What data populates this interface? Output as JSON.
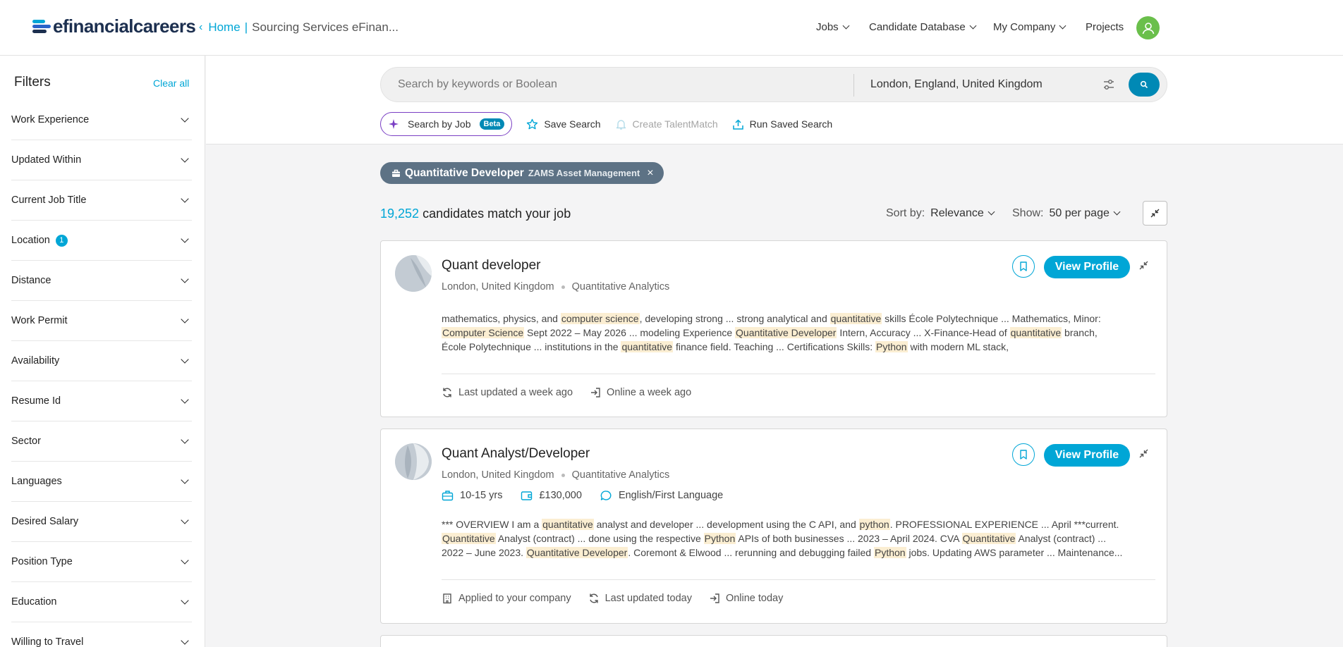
{
  "header": {
    "logo_text": "efinancialcareers",
    "breadcrumb_home": "Home",
    "breadcrumb_sep": "|",
    "breadcrumb_current": "Sourcing Services eFinan...",
    "nav": {
      "jobs": "Jobs",
      "candidate_database": "Candidate Database",
      "my_company": "My Company",
      "projects": "Projects"
    }
  },
  "sidebar": {
    "title": "Filters",
    "clear_all": "Clear all",
    "items": [
      {
        "label": "Work Experience"
      },
      {
        "label": "Updated Within"
      },
      {
        "label": "Current Job Title"
      },
      {
        "label": "Location",
        "count": "1"
      },
      {
        "label": "Distance"
      },
      {
        "label": "Work Permit"
      },
      {
        "label": "Availability"
      },
      {
        "label": "Resume Id"
      },
      {
        "label": "Sector"
      },
      {
        "label": "Languages"
      },
      {
        "label": "Desired Salary"
      },
      {
        "label": "Position Type"
      },
      {
        "label": "Education"
      },
      {
        "label": "Willing to Travel"
      }
    ]
  },
  "search": {
    "keyword_placeholder": "Search by keywords or Boolean",
    "location_value": "London, England, United Kingdom",
    "search_by_job": "Search by Job",
    "beta": "Beta",
    "save_search": "Save Search",
    "create_talentmatch": "Create TalentMatch",
    "run_saved_search": "Run Saved Search"
  },
  "job_chip": {
    "title": "Quantitative Developer",
    "company": "ZAMS Asset Management",
    "close": "×"
  },
  "results": {
    "count": "19,252",
    "count_suffix": "candidates match your job",
    "sort_label": "Sort by:",
    "sort_value": "Relevance",
    "show_label": "Show:",
    "show_value": "50 per page"
  },
  "candidates": [
    {
      "title": "Quant developer",
      "location": "London, United Kingdom",
      "sector": "Quantitative Analytics",
      "view_profile": "View Profile",
      "snippet_lines": [
        [
          "mathematics, physics, and ",
          "computer science",
          ", developing strong ... strong analytical and ",
          "quantitative",
          " skills École Polytechnique ... Mathematics, Minor:"
        ],
        [
          "",
          "Computer Science",
          " Sept 2022 – May 2026 ... modeling Experience ",
          "Quantitative Developer",
          " Intern, Accuracy ... X-Finance-Head of ",
          "quantitative",
          " branch,"
        ],
        [
          "École Polytechnique ... institutions in the ",
          "quantitative",
          " finance field. Teaching ... Certifications Skills: ",
          "Python",
          " with modern ML stack,"
        ]
      ],
      "footer": {
        "last_updated": "Last updated a week ago",
        "online": "Online a week ago"
      }
    },
    {
      "title": "Quant Analyst/Developer",
      "location": "London, United Kingdom",
      "sector": "Quantitative Analytics",
      "view_profile": "View Profile",
      "experience": "10-15 yrs",
      "salary": "£130,000",
      "language": "English/First Language",
      "snippet_lines": [
        [
          "*** OVERVIEW I am a ",
          "quantitative",
          " analyst and developer ... development using the C API, and ",
          "python",
          ". PROFESSIONAL EXPERIENCE ... April ***current."
        ],
        [
          "",
          "Quantitative",
          " Analyst (contract) ... done using the respective ",
          "Python",
          " APIs of both businesses ... 2023 – April 2024. CVA ",
          "Quantitative",
          " Analyst (contract) ..."
        ],
        [
          "2022 – June 2023. ",
          "Quantitative Developer",
          ". Coremont & Elwood ... rerunning and debugging failed ",
          "Python",
          " jobs. Updating AWS parameter ... Maintenance..."
        ]
      ],
      "footer": {
        "applied": "Applied to your company",
        "last_updated": "Last updated today",
        "online": "Online today"
      }
    }
  ],
  "colors": {
    "accent": "#00a6d6",
    "accent_dark": "#0089b5",
    "chip_bg": "#5d7285",
    "highlight": "#fbeed2",
    "avatar": "#6abf4b",
    "purple": "#7a3fc4"
  },
  "icons": [
    "logo-mark-icon",
    "chevron-left-icon",
    "caret-down-icon",
    "user-icon",
    "sliders-icon",
    "search-icon",
    "sparkle-icon",
    "star-icon",
    "bell-icon",
    "upload-icon",
    "briefcase-icon",
    "close-icon",
    "collapse-icon",
    "bookmark-icon",
    "refresh-icon",
    "login-icon",
    "building-icon",
    "wallet-icon",
    "chat-icon"
  ]
}
